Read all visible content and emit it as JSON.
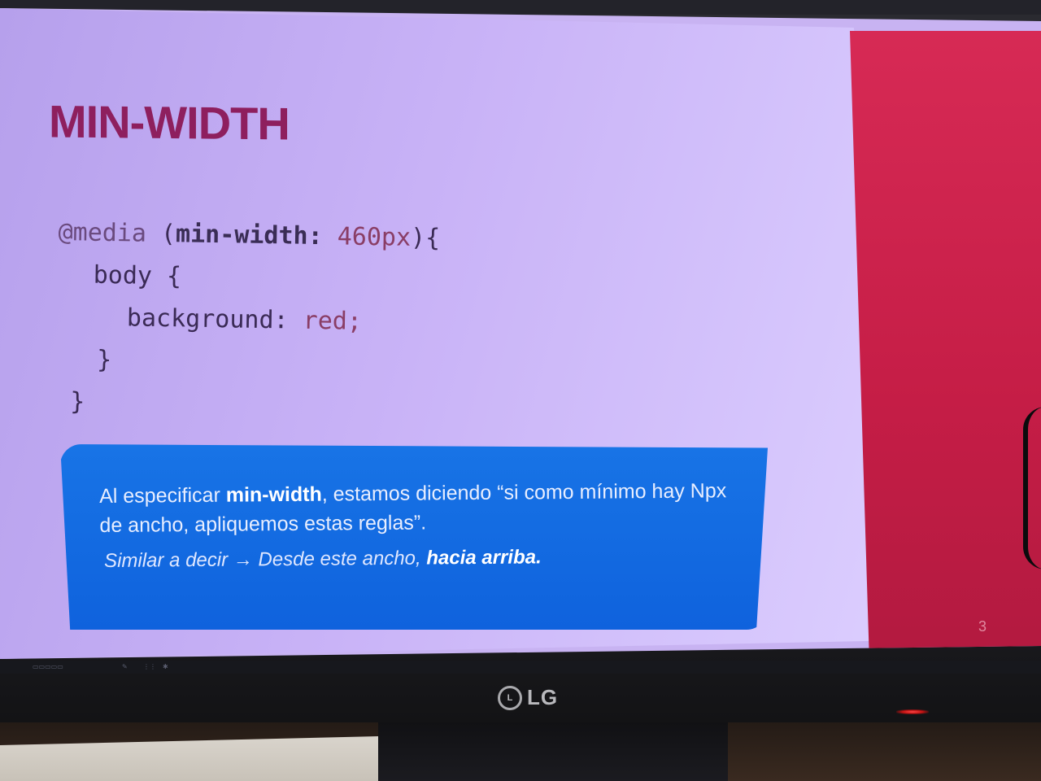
{
  "slide": {
    "title": "MIN-WIDTH",
    "code": {
      "line1_at": "@media",
      "line1_open": " (",
      "line1_prop": "min-width:",
      "line1_num": " 460px",
      "line1_close": "){",
      "line2": "body {",
      "line3_prop": "background:",
      "line3_val": " red;",
      "line4": "}",
      "line5": "}"
    },
    "callout": {
      "p1_a": "Al especificar ",
      "p1_bold": "min-width",
      "p1_b": ", estamos diciendo “si como mínimo hay Npx de ancho, apliquemos estas reglas”.",
      "p2_a": "Similar a decir → Desde este ancho, ",
      "p2_bold": "hacia arriba."
    },
    "page_number": "3"
  },
  "monitor": {
    "brand": "LG"
  },
  "colors": {
    "slide_background": "#c9b3f7",
    "title": "#8e1f5e",
    "callout_background": "#0f62dd",
    "side_panel": "#c51d46"
  }
}
